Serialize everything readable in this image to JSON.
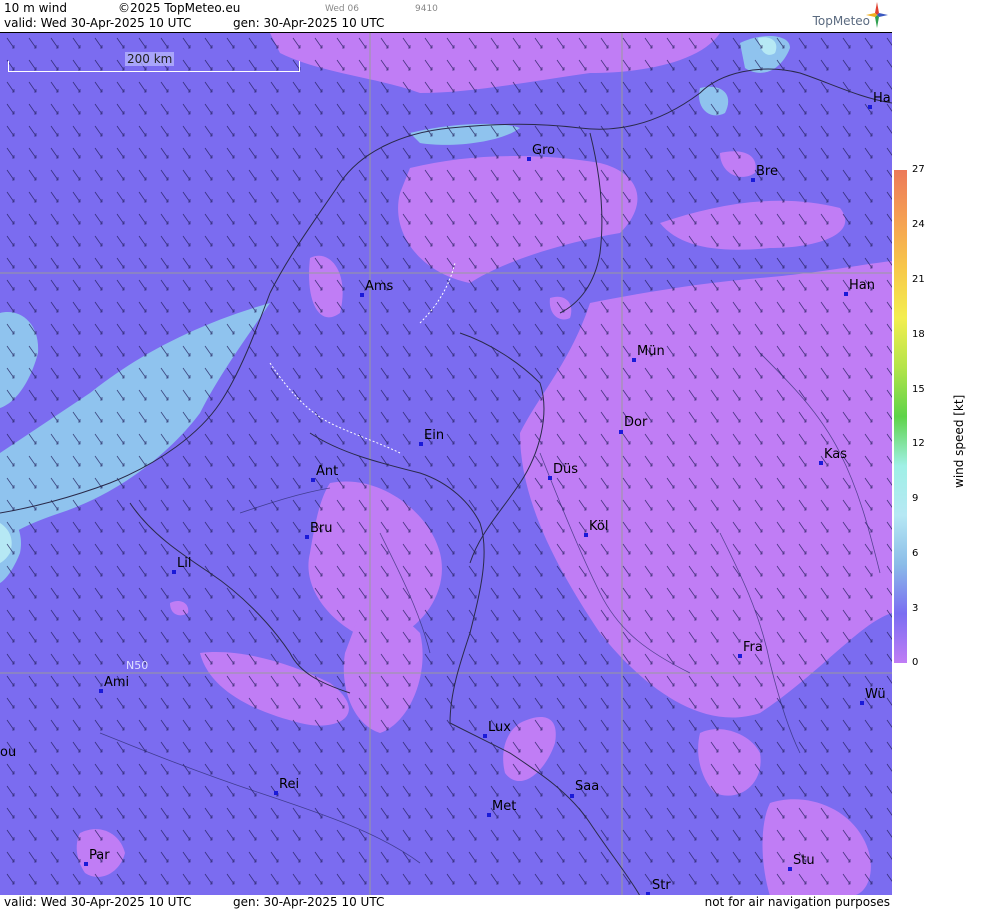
{
  "header": {
    "product": "10 m wind",
    "copyright": "©2025 TopMeteo.eu",
    "valid": "valid:  Wed  30-Apr-2025  10 UTC",
    "gen": "gen: 30-Apr-2025 10 UTC",
    "small_day": "Wed 06",
    "small_code": "9410",
    "brand": "TopMeteo"
  },
  "footer": {
    "valid": "valid:  Wed  30-Apr-2025  10 UTC",
    "gen": "gen: 30-Apr-2025 10 UTC",
    "disclaimer": "not for air navigation purposes"
  },
  "map": {
    "scale_label": "200 km",
    "lat_label": "N50",
    "cities": [
      {
        "name": "Gro"
      },
      {
        "name": "Bre"
      },
      {
        "name": "Ha"
      },
      {
        "name": "Ams"
      },
      {
        "name": "Han"
      },
      {
        "name": "Mün"
      },
      {
        "name": "Dor"
      },
      {
        "name": "Ein"
      },
      {
        "name": "Ant"
      },
      {
        "name": "Düs"
      },
      {
        "name": "Kas"
      },
      {
        "name": "Bru"
      },
      {
        "name": "Köl"
      },
      {
        "name": "Lil"
      },
      {
        "name": "Fra"
      },
      {
        "name": "Ami"
      },
      {
        "name": "Wü"
      },
      {
        "name": "Lux"
      },
      {
        "name": "ou"
      },
      {
        "name": "Rei"
      },
      {
        "name": "Saa"
      },
      {
        "name": "Met"
      },
      {
        "name": "Par"
      },
      {
        "name": "Stu"
      },
      {
        "name": "Str"
      }
    ]
  },
  "legend": {
    "title": "wind  speed  [kt]",
    "ticks": [
      "27",
      "24",
      "21",
      "18",
      "15",
      "12",
      "9",
      "6",
      "3",
      "0"
    ],
    "colors": [
      "#ec7a5a",
      "#f5a053",
      "#f7c84a",
      "#f3ee50",
      "#b4e44a",
      "#5fd34a",
      "#9ff0e6",
      "#b6e8f4",
      "#8bbce8",
      "#7a6df2",
      "#c07df5"
    ]
  },
  "colors": {
    "base": "#7b6cf0",
    "low": "#c07df5",
    "high": "#8fc3ee"
  }
}
